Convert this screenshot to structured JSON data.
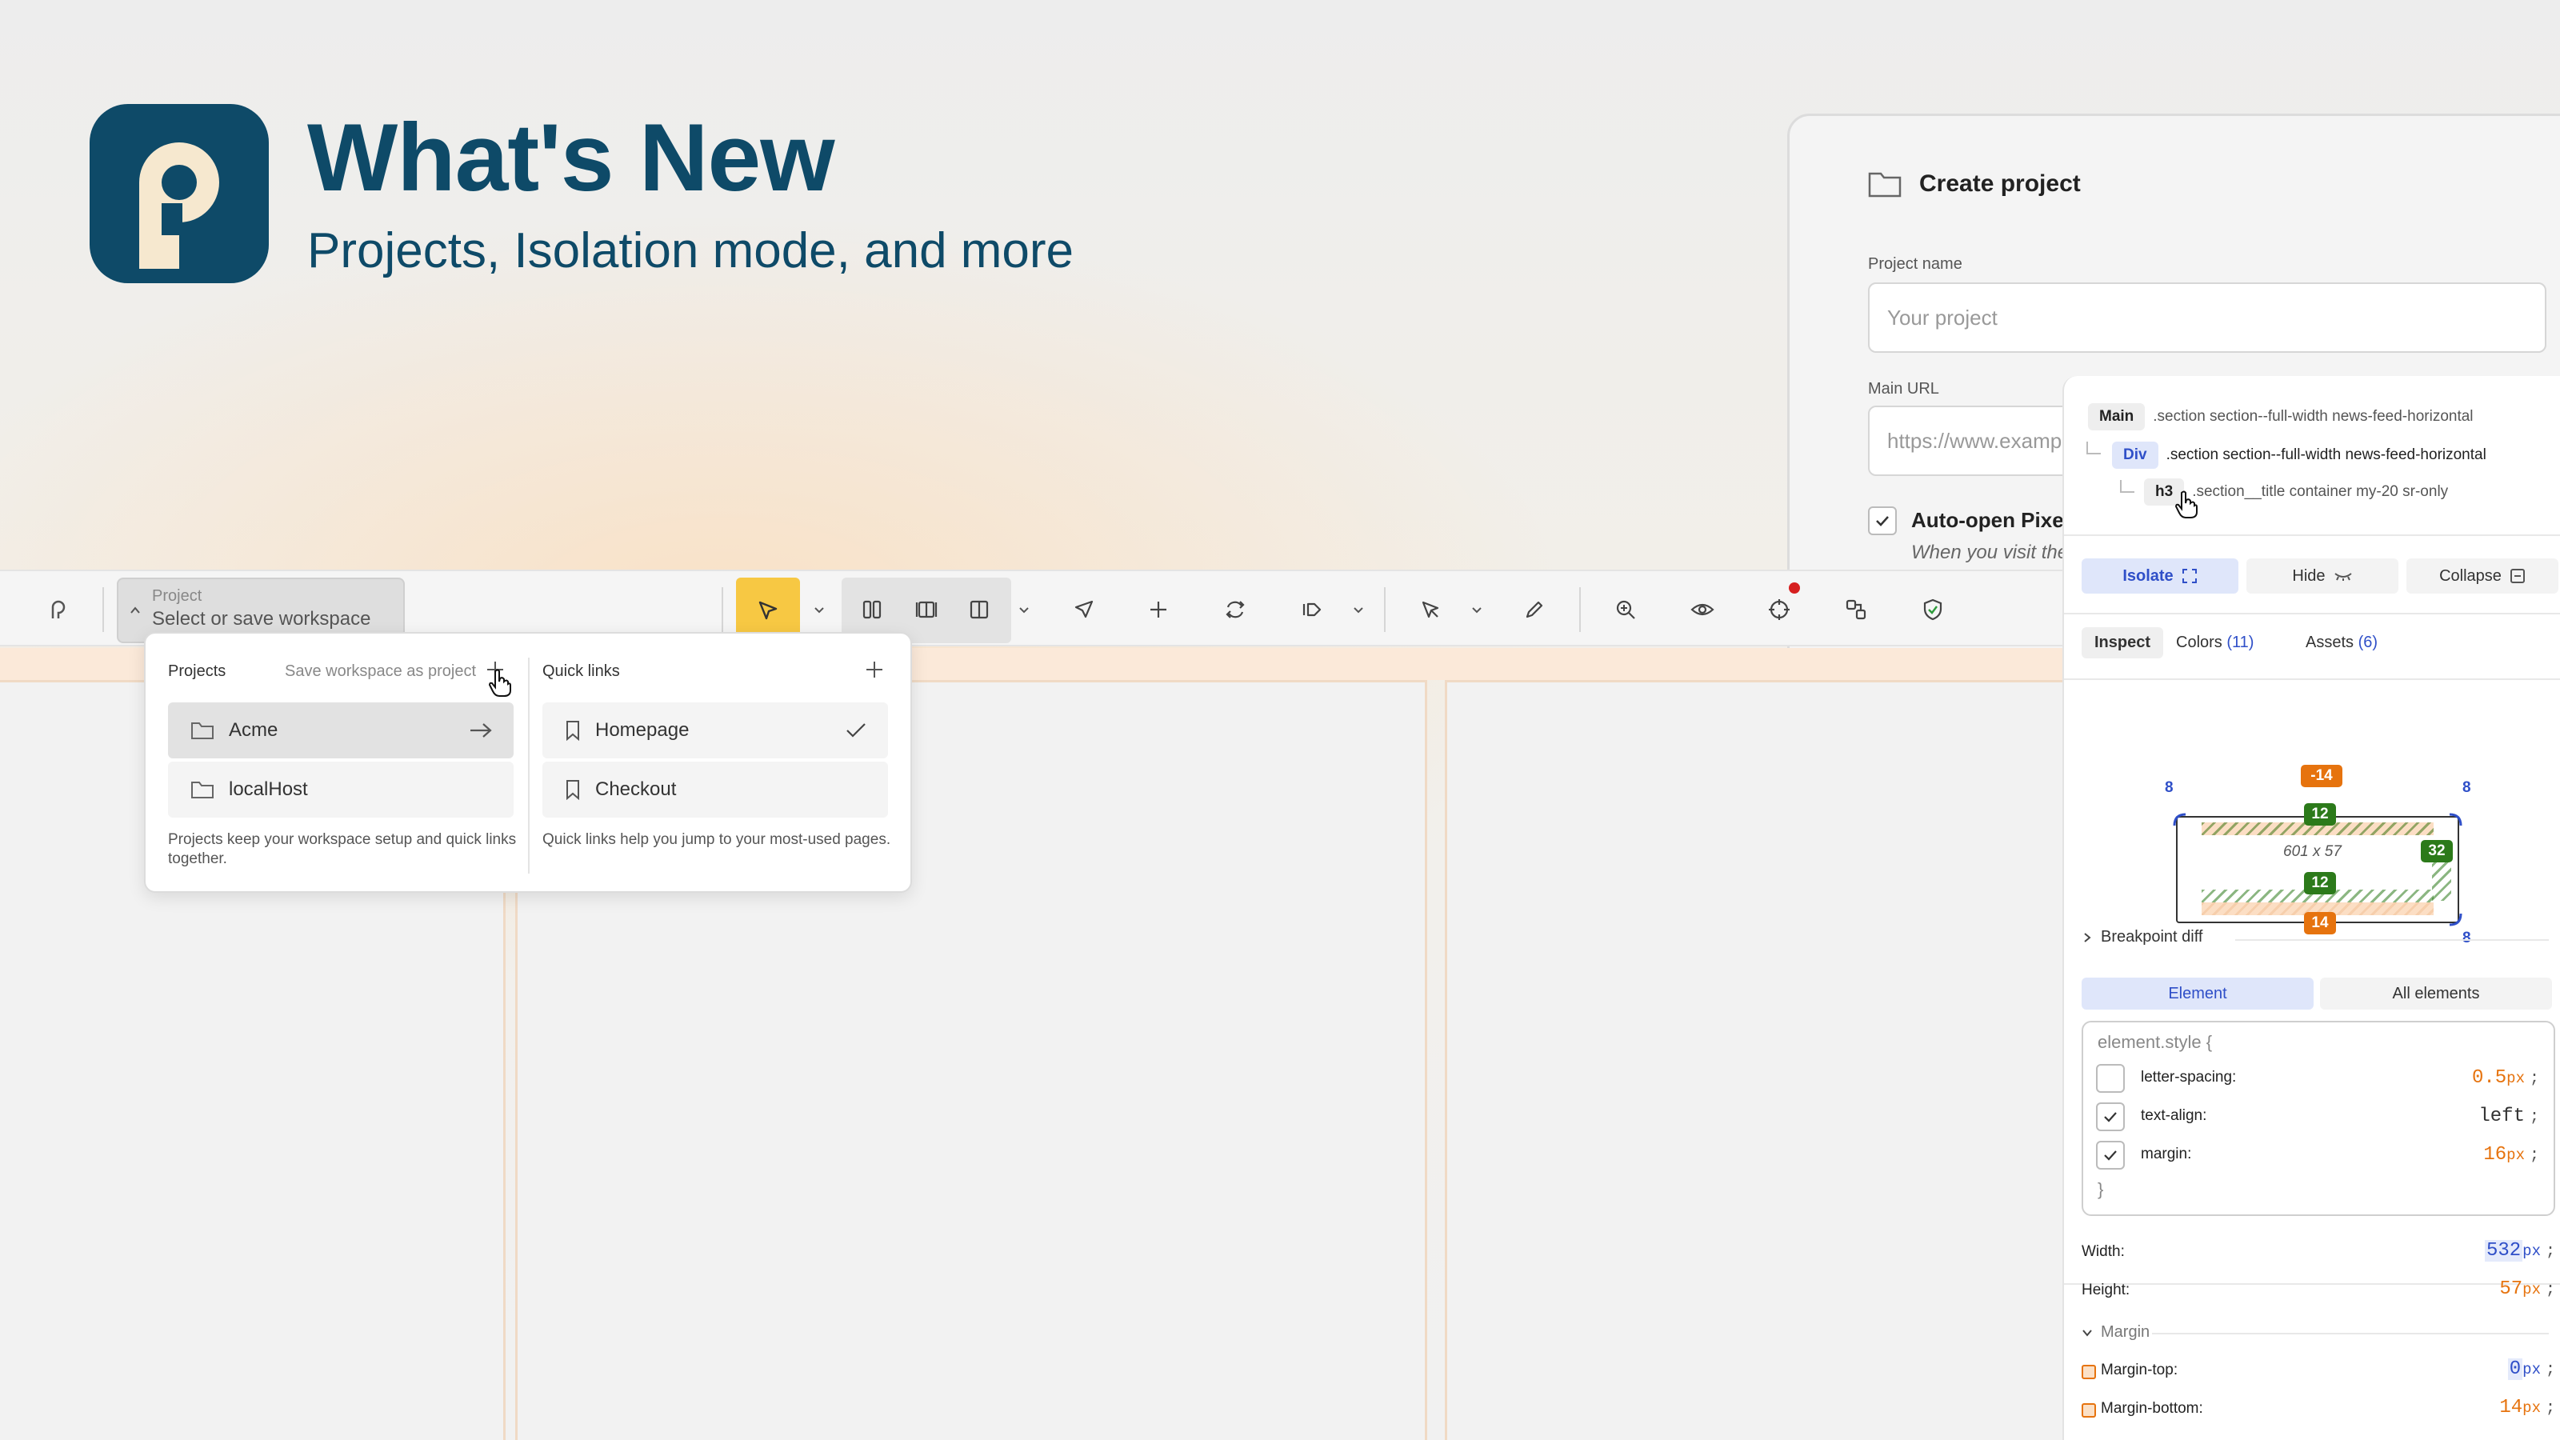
{
  "hero": {
    "title": "What's New",
    "subtitle": "Projects, Isolation mode, and more",
    "logo_icon": "pixefy-p-logo",
    "brand_color": "#0e4a68"
  },
  "create_project": {
    "title": "Create project",
    "name_label": "Project name",
    "name_placeholder": "Your project",
    "url_label": "Main URL",
    "url_placeholder": "https://www.exampl",
    "auto_open_label": "Auto-open Pixefy",
    "auto_open_hint": "When you visit the"
  },
  "toolbar": {
    "project_label": "Project",
    "project_value": "Select or save workspace",
    "icons": [
      "pixefy-icon",
      "select-cursor-icon",
      "columns-icon",
      "split-v-icon",
      "split-h-icon",
      "pointer-icon",
      "crosshair-icon",
      "sync-icon",
      "forward-icon",
      "element-select-icon",
      "pencil-icon",
      "zoom-in-icon",
      "eye-icon",
      "target-icon",
      "flow-icon",
      "shield-check-icon"
    ],
    "accent": "#f7c843"
  },
  "dropdown": {
    "projects_header": "Projects",
    "save_action": "Save workspace as project",
    "projects": [
      "Acme",
      "localHost"
    ],
    "projects_note": "Projects keep your workspace setup and quick links together.",
    "quicklinks_header": "Quick links",
    "quicklinks": [
      "Homepage",
      "Checkout"
    ],
    "quicklinks_note": "Quick links help you jump to your most-used pages."
  },
  "inspector": {
    "crumbs": [
      {
        "tag": "Main",
        "cls": ".section section--full-width news-feed-horizontal"
      },
      {
        "tag": "Div",
        "cls": ".section section--full-width news-feed-horizontal"
      },
      {
        "tag": "h3",
        "cls": ".section__title container my-20 sr-only"
      }
    ],
    "actions": {
      "isolate": "Isolate",
      "hide": "Hide",
      "collapse": "Collapse"
    },
    "tabs": {
      "inspect": "Inspect",
      "colors": "Colors",
      "colors_count": "(11)",
      "assets": "Assets",
      "assets_count": "(6)"
    },
    "box": {
      "margin_top": "-14",
      "padding_top": "12",
      "padding_right": "32",
      "padding_bottom": "12",
      "margin_bottom": "14",
      "dims": "601 x 57",
      "corner_tl": "8",
      "corner_tr": "8",
      "corner_br": "8"
    },
    "breakpoint_diff": "Breakpoint diff",
    "segment": {
      "element": "Element",
      "all": "All elements"
    },
    "style": {
      "open": "element.style {",
      "close": "}",
      "rows": [
        {
          "prop": "letter-spacing:",
          "value": "0.5",
          "unit": "px",
          "checked": false
        },
        {
          "prop": "text-align:",
          "value": "left",
          "unit": "",
          "checked": true
        },
        {
          "prop": "margin:",
          "value": "16",
          "unit": "px",
          "checked": true
        }
      ]
    },
    "width_label": "Width:",
    "width_value": "532",
    "width_unit": "px",
    "height_label": "Height:",
    "height_value": "57",
    "height_unit": "px",
    "margin_section": "Margin",
    "margin_top_label": "Margin-top:",
    "margin_top_value": "0",
    "margin_top_unit": "px",
    "margin_bottom_label": "Margin-bottom:",
    "margin_bottom_value": "14",
    "margin_bottom_unit": "px",
    "semicolon": ";"
  }
}
